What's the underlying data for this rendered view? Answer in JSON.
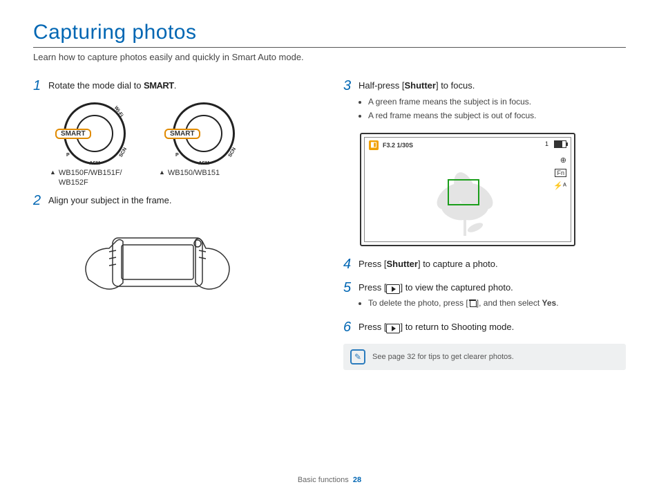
{
  "title": "Capturing photos",
  "lead": "Learn how to capture photos easily and quickly in Smart Auto mode.",
  "left": {
    "step1_pre": "Rotate the mode dial to ",
    "step1_mode": "SMART",
    "step1_post": ".",
    "dial_label": "SMART",
    "dial_marks": {
      "p": "P",
      "asm": "ASM",
      "scn": "SCN",
      "wifi": "Wi-Fi"
    },
    "dial1_caption": "WB150F/WB151F/ WB152F",
    "dial2_caption": "WB150/WB151",
    "step2": "Align your subject in the frame."
  },
  "right": {
    "step3_pre": "Half-press [",
    "step3_btn": "Shutter",
    "step3_post": "] to focus.",
    "step3_bullets": [
      "A green frame means the subject is in focus.",
      "A red frame means the subject is out of focus."
    ],
    "osd": {
      "exposure": "F3.2 1/30S",
      "shots": "1",
      "zoom": "⊕",
      "fn": "Fn",
      "flash": "⚡ᴬ"
    },
    "step4_pre": "Press [",
    "step4_btn": "Shutter",
    "step4_post": "] to capture a photo.",
    "step5_pre": "Press [",
    "step5_post": "] to view the captured photo.",
    "step5_bullet_pre": "To delete the photo, press [",
    "step5_bullet_post": "], and then select ",
    "step5_yes": "Yes",
    "step6_pre": "Press [",
    "step6_post": "] to return to Shooting mode.",
    "tip": "See page 32 for tips to get clearer photos."
  },
  "footer": {
    "section": "Basic functions",
    "page": "28"
  }
}
